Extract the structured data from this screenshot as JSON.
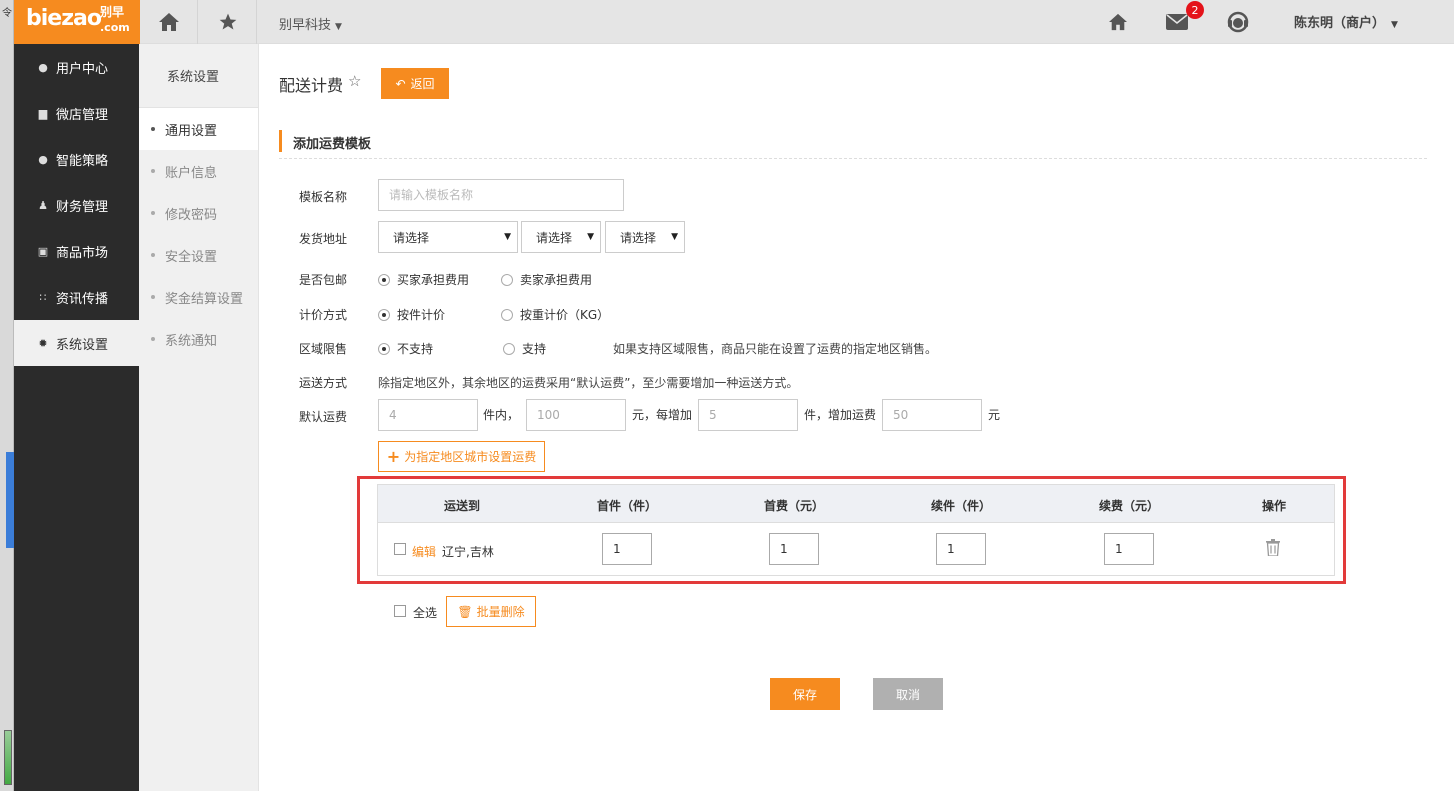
{
  "brand": {
    "word": "biezao",
    "cn": "别早",
    "com": ".com",
    "color": "#f68b1f"
  },
  "topbar": {
    "company": "别早科技",
    "message_count": "2",
    "user": "陈东明（商户）"
  },
  "sidebar": {
    "items": [
      {
        "label": "用户中心",
        "icon": "user-icon"
      },
      {
        "label": "微店管理",
        "icon": "store-icon"
      },
      {
        "label": "智能策略",
        "icon": "bomb-icon"
      },
      {
        "label": "财务管理",
        "icon": "money-bag-icon"
      },
      {
        "label": "商品市场",
        "icon": "picture-icon"
      },
      {
        "label": "资讯传播",
        "icon": "grid-icon"
      },
      {
        "label": "系统设置",
        "icon": "gear-icon"
      }
    ],
    "active": "系统设置"
  },
  "subnav": {
    "title": "系统设置",
    "items": [
      "通用设置",
      "账户信息",
      "修改密码",
      "安全设置",
      "奖金结算设置",
      "系统通知"
    ],
    "active": "通用设置"
  },
  "page": {
    "title": "配送计费",
    "back_label": "返回",
    "section_title": "添加运费模板"
  },
  "form": {
    "name_label": "模板名称",
    "name_placeholder": "请输入模板名称",
    "address_label": "发货地址",
    "address_selects": [
      "请选择",
      "请选择",
      "请选择"
    ],
    "free_label": "是否包邮",
    "free_options": [
      "买家承担费用",
      "卖家承担费用"
    ],
    "pricing_label": "计价方式",
    "pricing_options": [
      "按件计价",
      "按重计价（KG）"
    ],
    "region_label": "区域限售",
    "region_options": [
      "不支持",
      "支持"
    ],
    "region_hint": "如果支持区域限售，商品只能在设置了运费的指定地区销售。",
    "method_label": "运送方式",
    "method_hint": "除指定地区外，其余地区的运费采用“默认运费”，至少需要增加一种运送方式。",
    "default_label": "默认运费",
    "default_values": {
      "first_count": "4",
      "first_fee": "100",
      "add_count": "5",
      "add_fee": "50"
    },
    "units": {
      "u1": "件内，",
      "u2": "元，每增加",
      "u3": "件，增加运费",
      "u4": "元"
    },
    "add_region_label": "为指定地区城市设置运费"
  },
  "table": {
    "headers": [
      "运送到",
      "首件（件）",
      "首费（元）",
      "续件（件）",
      "续费（元）",
      "操作"
    ],
    "rows": [
      {
        "edit": "编辑",
        "region": "辽宁,吉林",
        "first_count": "1",
        "first_fee": "1",
        "add_count": "1",
        "add_fee": "1"
      }
    ]
  },
  "bulk": {
    "select_all": "全选",
    "delete_label": "批量删除"
  },
  "actions": {
    "save": "保存",
    "cancel": "取消"
  }
}
